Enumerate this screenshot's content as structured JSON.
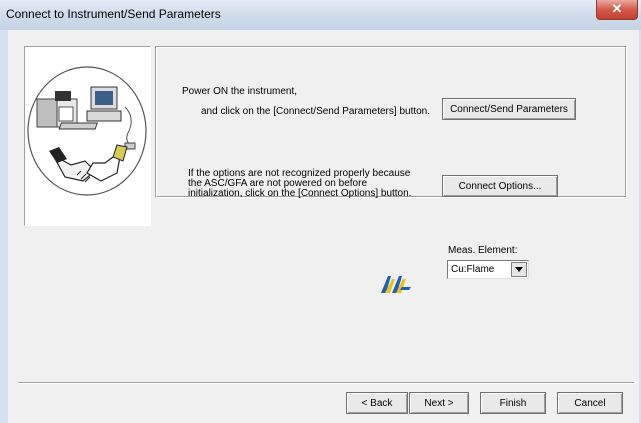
{
  "window": {
    "title": "Connect to Instrument/Send Parameters",
    "close_label": "✕"
  },
  "instructions": {
    "power_on": "Power ON the instrument,",
    "click_connect": "and click on the [Connect/Send Parameters] button.",
    "options_note_1": "If the options are not recognized properly because",
    "options_note_2": "the ASC/GFA are not powered on before",
    "options_note_3": "initialization, click on the [Connect Options] button."
  },
  "buttons": {
    "connect_send": "Connect/Send Parameters",
    "connect_options": "Connect Options...",
    "back": "< Back",
    "next": "Next >",
    "finish": "Finish",
    "cancel": "Cancel"
  },
  "meas_element": {
    "label": "Meas. Element:",
    "selected": "Cu:Flame"
  },
  "icons": {
    "illustration": "instrument-pc-handshake-illustration",
    "logo": "aa-logo-icon",
    "dropdown": "chevron-down-icon"
  },
  "colors": {
    "title_bar": "#cfdbea",
    "close_button": "#d2594a",
    "dialog_bg": "#f0f0f0",
    "logo_blue": "#1f5fb5",
    "logo_yellow": "#e8c21a"
  }
}
